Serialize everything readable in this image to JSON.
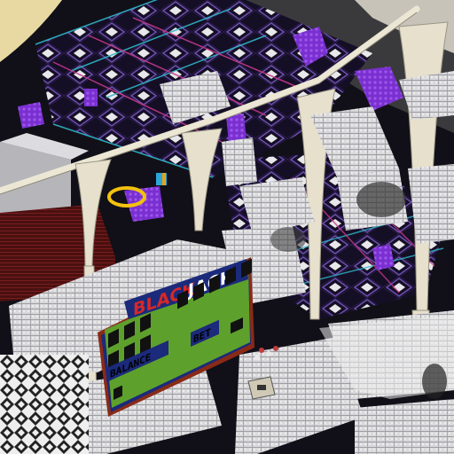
{
  "game": {
    "view": "isometric voxel casino build",
    "sign": {
      "title_part1": "BLACK",
      "title_part2": "JACK",
      "balance_label": "BALANCE",
      "bet_label": "BET"
    },
    "colors": {
      "floor_cyan_trim": "#2fb7c7",
      "floor_pink_trim": "#c4388a",
      "purple_blocks": "#7a2fd0",
      "sign_panel": "#1b2a7a",
      "sign_green": "#5ea02c",
      "sign_frame": "#8a2a16",
      "arch_stone": "#e6e0cc",
      "sand": "#e8d9a3"
    }
  }
}
